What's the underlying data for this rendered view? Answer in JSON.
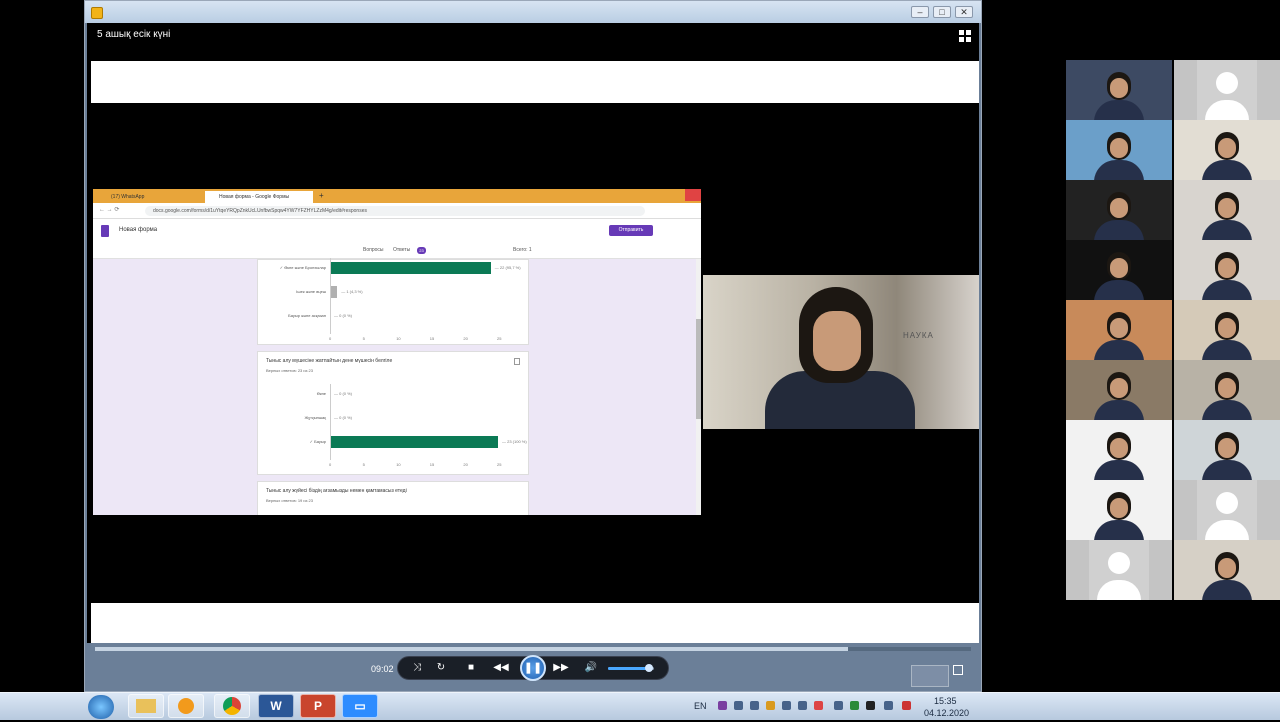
{
  "player": {
    "title": "5 ашық есік күні",
    "time": "09:02",
    "progress_fraction": 0.86,
    "volume_fraction": 0.9,
    "controls": {
      "share_icon": "share-icon",
      "loop_icon": "loop-icon",
      "stop_icon": "stop-icon",
      "rewind_icon": "rewind-icon",
      "pause_icon": "pause-icon",
      "forward_icon": "fast-forward-icon",
      "volume_icon": "volume-icon"
    }
  },
  "browser": {
    "tabs": [
      "(17) WhatsApp",
      "Новая форма - Google Формы"
    ],
    "url": "docs.google.com/forms/d/1uYtqeYRQpZnkUcLUnfbwSpqw4YW7YFZHYLZzM4g/edit#responses",
    "form_name": "Новая форма",
    "send_label": "Отправить",
    "subtabs": {
      "questions": "Вопросы",
      "answers": "Ответы",
      "answers_count": "23",
      "total": "Всего: 1"
    },
    "card1": {
      "rows": [
        {
          "label": "✓ Өкпе және Бронхылар",
          "value_text": "22 (95,7 %)",
          "fraction": 0.957
        },
        {
          "label": "Ішек және өңеш",
          "value_text": "1 (4,3 %)",
          "fraction": 0.043
        },
        {
          "label": "Бауыр және асқазан",
          "value_text": "0 (0 %)",
          "fraction": 0
        }
      ],
      "ticks": [
        "0",
        "5",
        "10",
        "15",
        "20",
        "25"
      ]
    },
    "card2": {
      "question": "Тыныс алу мүшесіне жатпайтын дене мүшесін белгіле",
      "subtitle": "Верных ответов: 23 из 23",
      "rows": [
        {
          "label": "Өкпе",
          "value_text": "0 (0 %)",
          "fraction": 0
        },
        {
          "label": "Жұтқыншақ",
          "value_text": "0 (0 %)",
          "fraction": 0
        },
        {
          "label": "✓ Бауыр",
          "value_text": "23 (100 %)",
          "fraction": 1
        }
      ],
      "ticks": [
        "0",
        "5",
        "10",
        "15",
        "20",
        "25"
      ]
    },
    "card3": {
      "question": "Тыныс алу жүйесі біздің ағзамызды немен қамтамасыз етеді",
      "subtitle": "Верных ответов: 19 из 23"
    }
  },
  "speaker": {
    "sign_text": "НАУКА"
  },
  "colors": {
    "bar_green": "#0b7a55",
    "bar_gray": "#b0b0b0",
    "accent_purple": "#673ab7"
  },
  "taskbar": {
    "apps": [
      "explorer-icon",
      "media-player-icon",
      "chrome-icon",
      "word-icon",
      "powerpoint-icon",
      "zoom-icon"
    ],
    "word_label": "W",
    "ppt_label": "P",
    "lang": "EN",
    "clock_time": "15:35",
    "clock_date": "04.12.2020"
  }
}
